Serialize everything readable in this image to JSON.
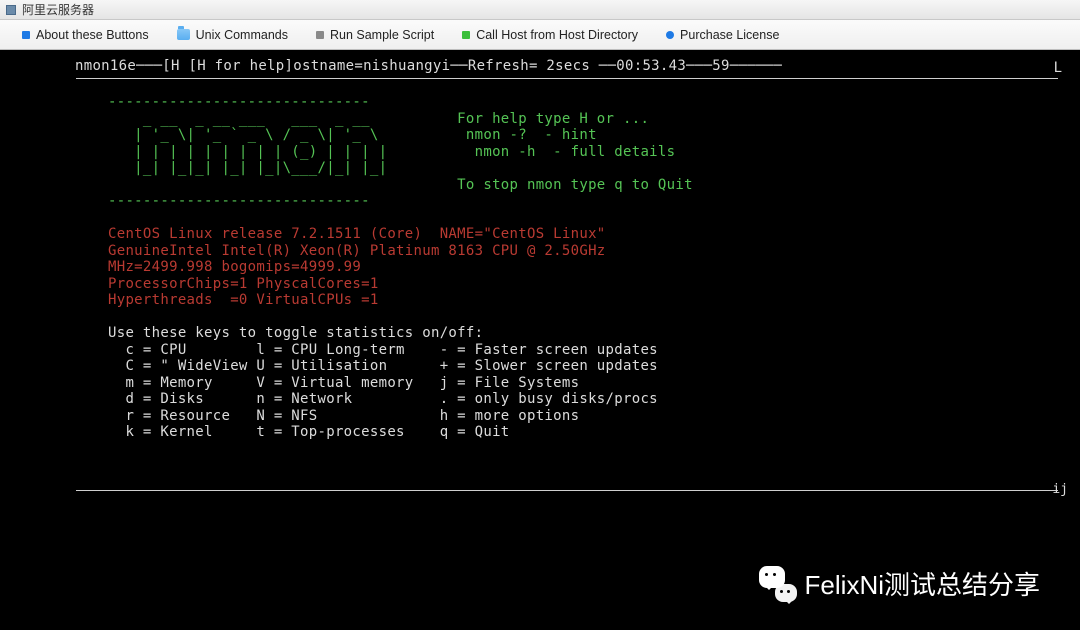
{
  "window": {
    "title": "阿里云服务器"
  },
  "toolbar": {
    "items": [
      {
        "label": "About these Buttons",
        "color": "#1e7ae5",
        "type": "dot"
      },
      {
        "label": "Unix Commands",
        "type": "folder"
      },
      {
        "label": "Run Sample Script",
        "color": "#8a8a8a",
        "type": "dot"
      },
      {
        "label": "Call Host from Host Directory",
        "color": "#3bbf3b",
        "type": "dot"
      },
      {
        "label": "Purchase License",
        "color": "#1e7ae5",
        "type": "dot"
      }
    ]
  },
  "header": {
    "version": "nmon16e",
    "help_hint": "[H [H for help]",
    "hostname_label": "ostname=",
    "hostname": "nishuangyi",
    "refresh_label": "Refresh=",
    "refresh": " 2secs ",
    "time": "00:53.43",
    "extra": "59",
    "right": "L"
  },
  "ascii": {
    "l1": "------------------------------",
    "l2": "    _ __  _ __ ___   ___  _ __          For help type H or ...",
    "l3": "   | '_ \\| '_ ` _ \\ / _ \\| '_ \\          nmon -?  - hint",
    "l4": "   | | | | | | | | | (_) | | | |          nmon -h  - full details",
    "l5": "   |_| |_|_| |_| |_|\\___/|_| |_|",
    "l6": "                                        To stop nmon type q to Quit",
    "l7": "------------------------------"
  },
  "sys": {
    "l1": "CentOS Linux release 7.2.1511 (Core)  NAME=\"CentOS Linux\"",
    "l2": "GenuineIntel Intel(R) Xeon(R) Platinum 8163 CPU @ 2.50GHz",
    "l3": "MHz=2499.998 bogomips=4999.99",
    "l4": "ProcessorChips=1 PhyscalCores=1",
    "l5": "Hyperthreads  =0 VirtualCPUs =1"
  },
  "keys": {
    "title": "Use these keys to toggle statistics on/off:",
    "l1": "  c = CPU        l = CPU Long-term    - = Faster screen updates",
    "l2": "  C = \" WideView U = Utilisation      + = Slower screen updates",
    "l3": "  m = Memory     V = Virtual memory   j = File Systems",
    "l4": "  d = Disks      n = Network          . = only busy disks/procs",
    "l5": "  r = Resource   N = NFS              h = more options",
    "l6": "  k = Kernel     t = Top-processes    q = Quit"
  },
  "corner": {
    "ij": "ij"
  },
  "watermark": {
    "text": "FelixNi测试总结分享"
  }
}
